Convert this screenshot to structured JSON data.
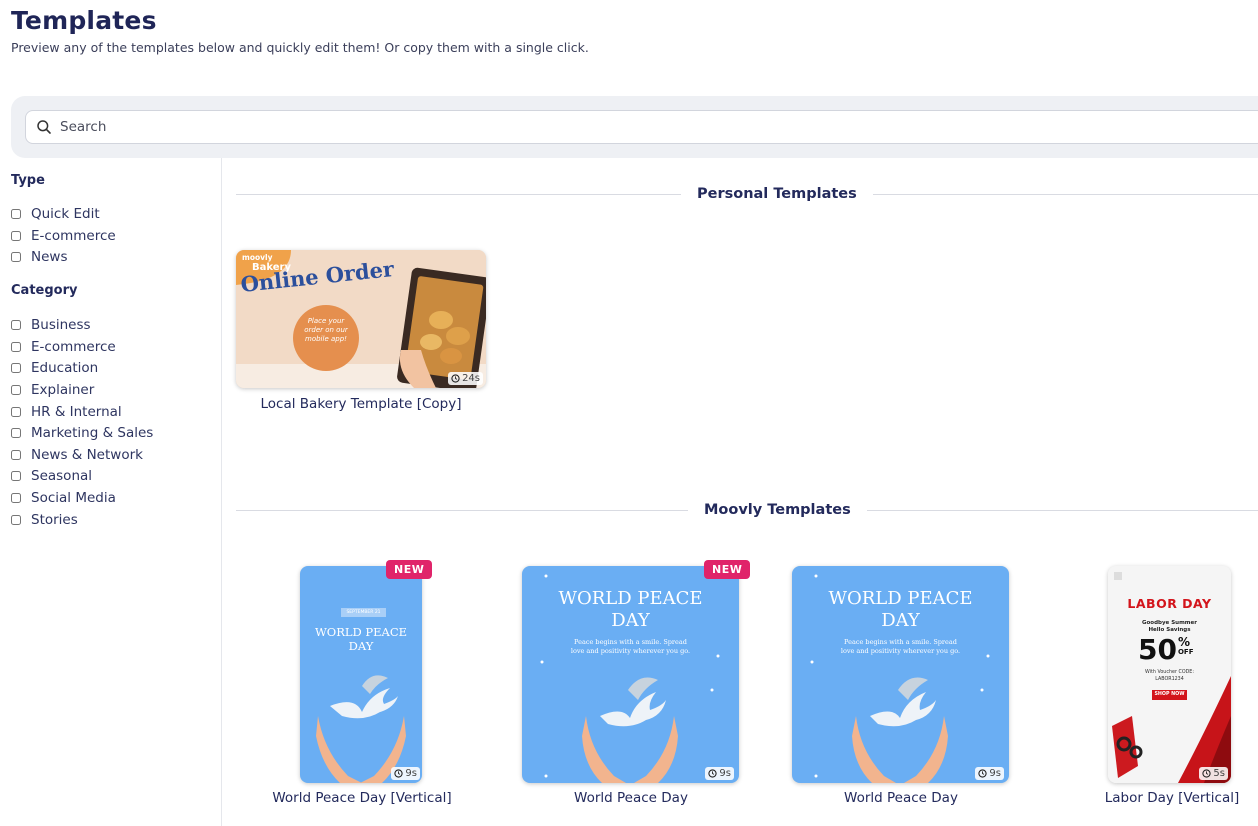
{
  "header": {
    "title": "Templates",
    "subtitle": "Preview any of the templates below and quickly edit them! Or copy them with a single click."
  },
  "search": {
    "placeholder": "Search",
    "icon": "search-icon"
  },
  "filters": {
    "type": {
      "title": "Type",
      "options": [
        "Quick Edit",
        "E-commerce",
        "News"
      ]
    },
    "category": {
      "title": "Category",
      "options": [
        "Business",
        "E-commerce",
        "Education",
        "Explainer",
        "HR & Internal",
        "Marketing & Sales",
        "News & Network",
        "Seasonal",
        "Social Media",
        "Stories"
      ]
    }
  },
  "personal_templates": {
    "title": "Personal Templates",
    "cards": [
      {
        "label": "Local Bakery Template [Copy]",
        "duration": "24s",
        "thumb": {
          "brand_line1": "moovly",
          "brand_line2": "Bakery",
          "headline": "Online Order",
          "bubble_text": "Place your order on our mobile app!"
        }
      }
    ]
  },
  "moovly_templates": {
    "title": "Moovly Templates",
    "new_label": "NEW",
    "cards": [
      {
        "label": "World Peace Day [Vertical]",
        "duration": "9s",
        "is_new": true,
        "thumb": {
          "date": "SEPTEMBER 21",
          "title_line1": "WORLD PEACE",
          "title_line2": "DAY"
        }
      },
      {
        "label": "World Peace Day",
        "duration": "9s",
        "is_new": true,
        "thumb": {
          "title_line1": "WORLD PEACE",
          "title_line2": "DAY",
          "text_line1": "Peace begins with a smile. Spread",
          "text_line2": "love and positivity wherever you go."
        }
      },
      {
        "label": "World Peace Day",
        "duration": "9s",
        "is_new": false,
        "thumb": {
          "title_line1": "WORLD PEACE",
          "title_line2": "DAY",
          "text_line1": "Peace begins with a smile. Spread",
          "text_line2": "love and positivity wherever you go."
        }
      },
      {
        "label": "Labor Day [Vertical]",
        "duration": "5s",
        "is_new": false,
        "thumb": {
          "headline": "LABOR DAY",
          "sub1": "Goodbye Summer",
          "sub2": "Hello Savings",
          "percent": "50",
          "percent_sign": "%",
          "off": "OFF",
          "voucher1": "With Voucher CODE:",
          "voucher2": "LABOR1234",
          "cta": "SHOP NOW"
        }
      }
    ]
  },
  "colors": {
    "accent_navy": "#232a5c",
    "new_badge": "#e0246a",
    "peace_blue": "#6aaef3",
    "labor_red": "#d3141b"
  }
}
